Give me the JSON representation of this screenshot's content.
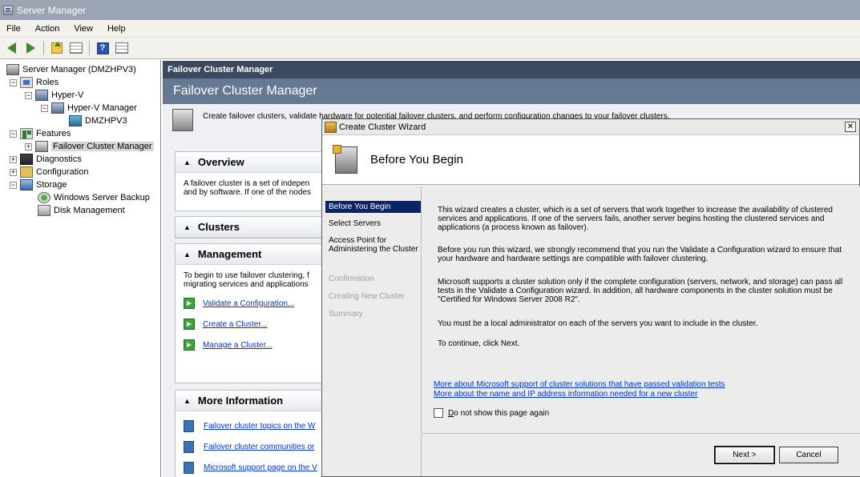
{
  "window": {
    "title": "Server Manager"
  },
  "menu": {
    "items": [
      "File",
      "Action",
      "View",
      "Help"
    ]
  },
  "tree": {
    "items": [
      {
        "label": "Server Manager (DMZHPV3)",
        "expander": ""
      },
      {
        "label": "Roles",
        "expander": "−"
      },
      {
        "label": "Hyper-V",
        "expander": "−"
      },
      {
        "label": "Hyper-V Manager",
        "expander": "−"
      },
      {
        "label": "DMZHPV3",
        "expander": ""
      },
      {
        "label": "Features",
        "expander": "−"
      },
      {
        "label": "Failover Cluster Manager",
        "expander": "+"
      },
      {
        "label": "Diagnostics",
        "expander": "+"
      },
      {
        "label": "Configuration",
        "expander": "+"
      },
      {
        "label": "Storage",
        "expander": "−"
      },
      {
        "label": "Windows Server Backup",
        "expander": ""
      },
      {
        "label": "Disk Management",
        "expander": ""
      }
    ]
  },
  "panel": {
    "header": "Failover Cluster Manager",
    "title": "Failover Cluster Manager",
    "intro": "Create failover clusters, validate hardware for potential failover clusters, and perform configuration changes to your failover clusters."
  },
  "overview": {
    "title": "Overview",
    "text1": "A failover cluster is a set of indepen",
    "text2": "and by software. If one of the nodes"
  },
  "clusters": {
    "title": "Clusters"
  },
  "management": {
    "title": "Management",
    "text1": "To begin to use failover clustering, f",
    "text2": "migrating services and applications",
    "actions": [
      "Validate a Configuration...",
      "Create a Cluster...",
      "Manage a Cluster..."
    ]
  },
  "more_info": {
    "title": "More Information",
    "links": [
      "Failover cluster topics on the W",
      "Failover cluster communities or",
      "Microsoft support page on the V"
    ]
  },
  "wizard": {
    "title": "Create Cluster Wizard",
    "close": "✕",
    "banner_title": "Before You Begin",
    "steps": [
      "Before You Begin",
      "Select Servers",
      "Access Point for Administering the Cluster",
      "Confirmation",
      "Creating New Cluster",
      "Summary"
    ],
    "paragraphs": [
      "This wizard creates a cluster, which is a set of servers that work together to increase the availability of clustered services and applications. If one of the servers fails, another server begins hosting the clustered services and applications (a process known as failover).",
      "Before you run this wizard, we strongly recommend that you run the Validate a Configuration wizard to ensure that your hardware and hardware settings are compatible with failover clustering.",
      "Microsoft supports a cluster solution only if the complete configuration (servers, network, and storage) can pass all tests in the Validate a Configuration wizard. In addition, all hardware components in the cluster solution must be \"Certified for Windows Server 2008 R2\".",
      "You must be a local administrator on each of the servers you want to include in the cluster.",
      "To continue, click Next."
    ],
    "links": [
      "More about Microsoft support of cluster solutions that have passed validation tests",
      "More about the name and IP address information needed for a new cluster"
    ],
    "checkbox_label": "Do not show this page again",
    "next_label": "Next >",
    "cancel_label": "Cancel"
  }
}
